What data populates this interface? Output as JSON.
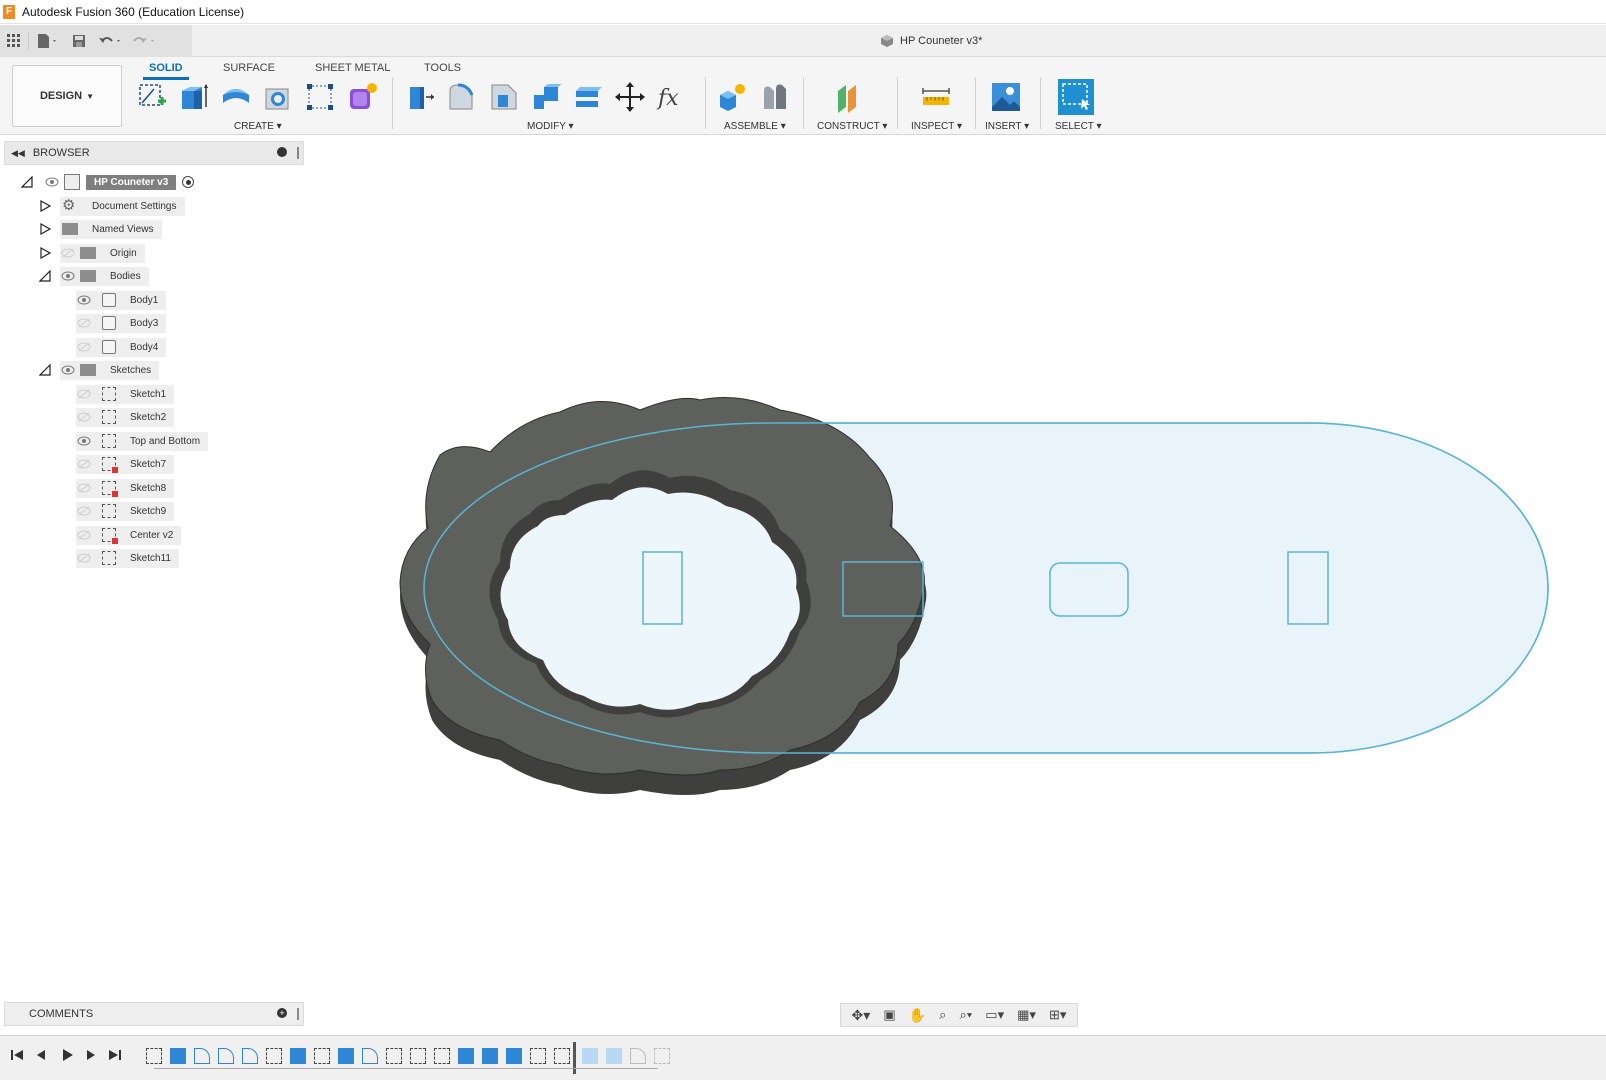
{
  "app": {
    "title": "Autodesk Fusion 360 (Education License)",
    "logo_letter": "F"
  },
  "document": {
    "title": "HP Couneter v3*"
  },
  "workspace": {
    "label": "DESIGN"
  },
  "tabs": [
    {
      "label": "SOLID",
      "active": true
    },
    {
      "label": "SURFACE",
      "active": false
    },
    {
      "label": "SHEET METAL",
      "active": false
    },
    {
      "label": "TOOLS",
      "active": false
    }
  ],
  "groups": {
    "create": "CREATE",
    "modify": "MODIFY",
    "assemble": "ASSEMBLE",
    "construct": "CONSTRUCT",
    "inspect": "INSPECT",
    "insert": "INSERT",
    "select": "SELECT"
  },
  "browser": {
    "title": "BROWSER",
    "root": "HP Couneter v3",
    "items": [
      {
        "label": "Document Settings"
      },
      {
        "label": "Named Views"
      },
      {
        "label": "Origin"
      },
      {
        "label": "Bodies"
      },
      {
        "label": "Body1"
      },
      {
        "label": "Body3"
      },
      {
        "label": "Body4"
      },
      {
        "label": "Sketches"
      },
      {
        "label": "Sketch1"
      },
      {
        "label": "Sketch2"
      },
      {
        "label": "Top and Bottom"
      },
      {
        "label": "Sketch7"
      },
      {
        "label": "Sketch8"
      },
      {
        "label": "Sketch9"
      },
      {
        "label": "Center v2"
      },
      {
        "label": "Sketch11"
      }
    ]
  },
  "comments": {
    "title": "COMMENTS"
  },
  "colors": {
    "accent": "#0b6fb8",
    "body_top": "#5e605c",
    "body_side": "#3f403d",
    "sketch_profile": "#e8f3fa",
    "sketch_line": "#5bb4d3",
    "select_tool": "#1e8fd0"
  },
  "icons": {
    "qat": [
      "app-grid-icon",
      "file-icon",
      "save-icon",
      "undo-icon",
      "redo-icon"
    ],
    "timeline": [
      "go-to-start-icon",
      "step-back-icon",
      "play-icon",
      "step-forward-icon",
      "go-to-end-icon"
    ]
  }
}
